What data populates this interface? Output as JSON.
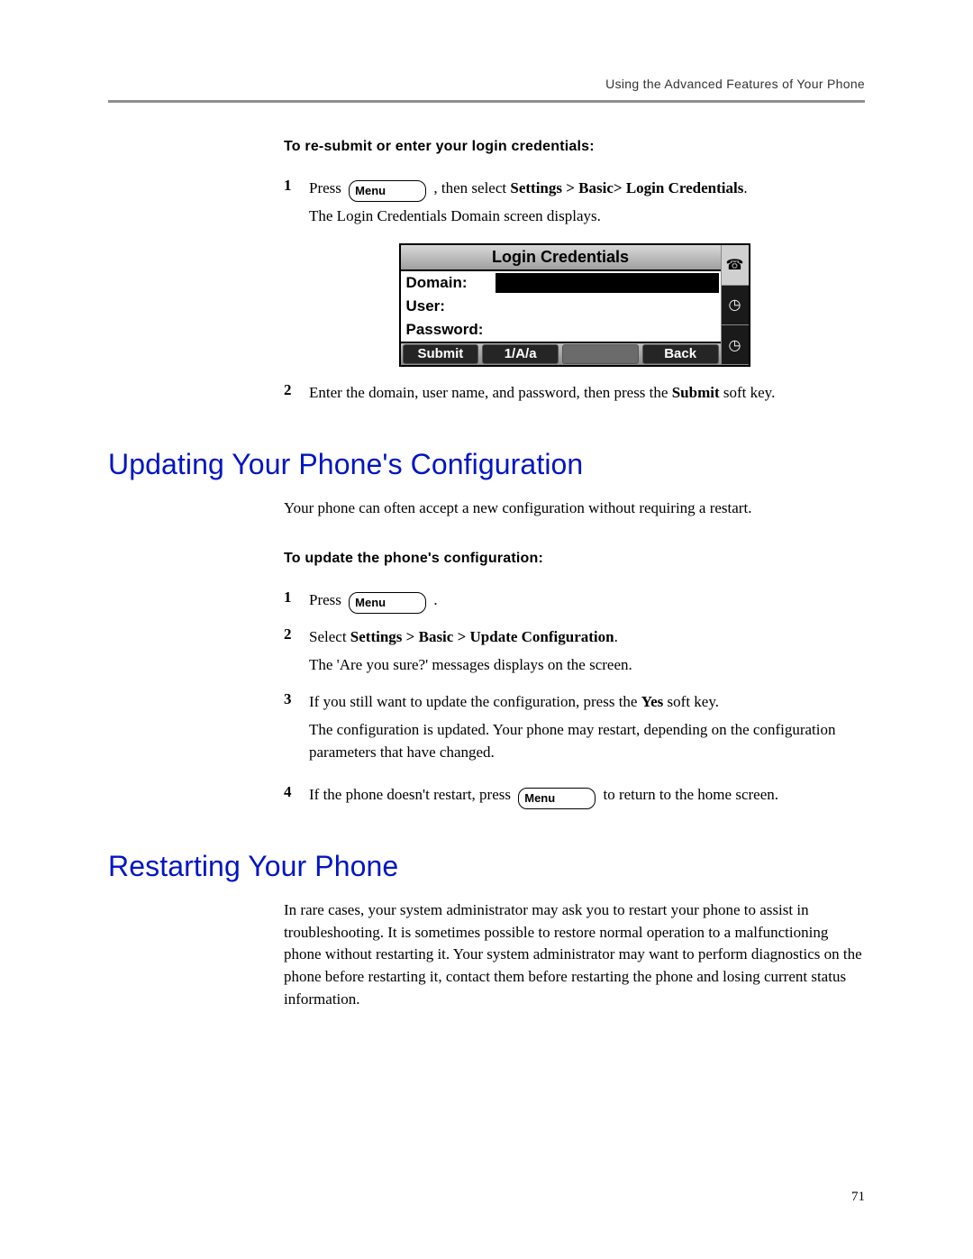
{
  "header": {
    "running_title": "Using the Advanced Features of Your Phone"
  },
  "menu_button_label": "Menu",
  "section1": {
    "subheading": "To re-submit or enter your login credentials:",
    "step1": {
      "num": "1",
      "press": "Press",
      "after_btn": " , then select ",
      "path": "Settings > Basic> Login Credentials",
      "period": ".",
      "line2": "The Login Credentials Domain screen displays."
    },
    "screen": {
      "title": "Login Credentials",
      "domain_label": "Domain:",
      "user_label": "User:",
      "password_label": "Password:",
      "sk_submit": "Submit",
      "sk_mode": "1/A/a",
      "sk_back": "Back"
    },
    "step2": {
      "num": "2",
      "text_a": "Enter the domain, user name, and password, then press the ",
      "bold": "Submit",
      "text_b": " soft key."
    }
  },
  "section2": {
    "heading": "Updating Your Phone's Configuration",
    "intro": "Your phone can often accept a new configuration without requiring a restart.",
    "subheading": "To update the phone's configuration:",
    "step1": {
      "num": "1",
      "press": "Press",
      "after": " ."
    },
    "step2": {
      "num": "2",
      "text_a": "Select ",
      "bold": "Settings > Basic > Update Configuration",
      "period": ".",
      "line2": "The 'Are you sure?' messages displays on the screen."
    },
    "step3": {
      "num": "3",
      "text_a": "If you still want to update the configuration, press the ",
      "bold": "Yes",
      "text_b": " soft key.",
      "line2": "The configuration is updated. Your phone may restart, depending on the configuration parameters that have changed."
    },
    "step4": {
      "num": "4",
      "text_a": "If the phone doesn't restart, press ",
      "text_b": " to return to the home screen."
    }
  },
  "section3": {
    "heading": "Restarting Your Phone",
    "intro": "In rare cases, your system administrator may ask you to restart your phone to assist in troubleshooting. It is sometimes possible to restore normal operation to a malfunctioning phone without restarting it. Your system administrator may want to perform diagnostics on the phone before restarting it, contact them before restarting the phone and losing current status information."
  },
  "page_number": "71"
}
